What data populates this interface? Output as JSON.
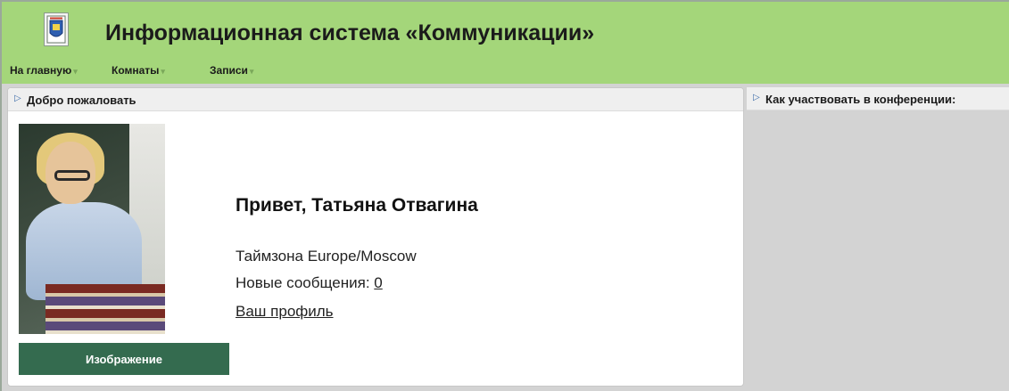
{
  "header": {
    "title": "Информационная система «Коммуникации»",
    "logo_icon": "emblem-logo-icon",
    "background": "#a4d67a"
  },
  "nav": {
    "items": [
      {
        "label": "На главную"
      },
      {
        "label": "Комнаты"
      },
      {
        "label": "Записи"
      }
    ]
  },
  "welcome_panel": {
    "title": "Добро пожаловать",
    "greeting": "Привет, Татьяна Отвагина",
    "timezone_label": "Таймзона",
    "timezone_value": "Europe/Moscow",
    "messages_label": "Новые сообщения:",
    "messages_count": "0",
    "profile_link": "Ваш профиль",
    "image_button": "Изображение",
    "button_color": "#346b4f"
  },
  "conference_panel": {
    "title": "Как участвовать в конференции:"
  }
}
